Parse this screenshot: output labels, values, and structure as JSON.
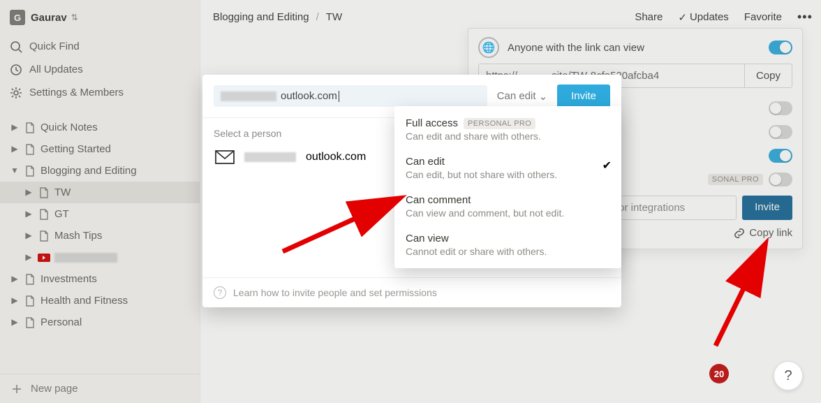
{
  "user": {
    "initial": "G",
    "name": "Gaurav"
  },
  "sidebar": {
    "sys": {
      "quick_find": "Quick Find",
      "all_updates": "All Updates",
      "settings": "Settings & Members"
    },
    "pages": {
      "quick_notes": "Quick Notes",
      "getting_started": "Getting Started",
      "blogging": "Blogging and Editing",
      "tw": "TW",
      "gt": "GT",
      "mash": "Mash Tips",
      "investments": "Investments",
      "health": "Health and Fitness",
      "personal": "Personal"
    },
    "new_page": "New page"
  },
  "breadcrumb": {
    "a": "Blogging and Editing",
    "b": "TW"
  },
  "topactions": {
    "share": "Share",
    "updates": "Updates",
    "favorite": "Favorite"
  },
  "share_panel": {
    "anyone": "Anyone with the link can view",
    "url": "https://……….site/TW-8cfa520afcba4",
    "copy": "Copy",
    "invite_ph": "Add people, emails, groups, or integrations",
    "invite": "Invite",
    "copy_link": "Copy link",
    "pro": "SONAL PRO"
  },
  "modal": {
    "email_suffix": "outlook.com",
    "perm_selected": "Can edit",
    "invite": "Invite",
    "select": "Select a person",
    "person_suffix": "outlook.com",
    "foot": "Learn how to invite people and set permissions"
  },
  "dropdown": [
    {
      "title": "Full access",
      "desc": "Can edit and share with others.",
      "badge": "PERSONAL PRO",
      "checked": false
    },
    {
      "title": "Can edit",
      "desc": "Can edit, but not share with others.",
      "badge": "",
      "checked": true
    },
    {
      "title": "Can comment",
      "desc": "Can view and comment, but not edit.",
      "badge": "",
      "checked": false
    },
    {
      "title": "Can view",
      "desc": "Cannot edit or share with others.",
      "badge": "",
      "checked": false
    }
  ],
  "badge20": "20",
  "help": "?"
}
